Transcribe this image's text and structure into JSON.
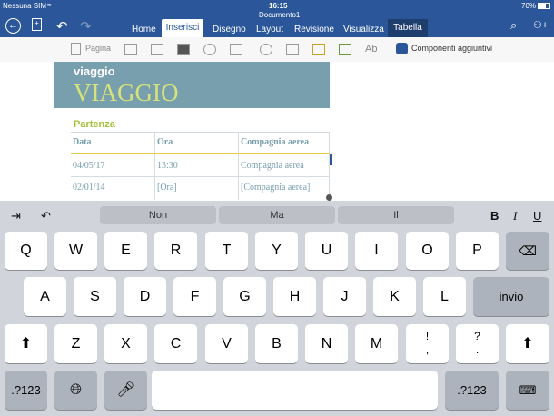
{
  "status": {
    "carrier": "Nessuna SIM",
    "time": "16:15",
    "battery": "70%",
    "doc_title": "Documento1"
  },
  "tabs": [
    "Home",
    "Inserisci",
    "Disegno",
    "Layout",
    "Revisione",
    "Visualizza",
    "Tabella"
  ],
  "ribbon": {
    "page_label": "Pagina",
    "wordart": "Ab",
    "addins_label": "Componenti aggiuntivi"
  },
  "doc": {
    "heading_small": "viaggio",
    "heading_big": "VIAGGIO",
    "section": "Partenza",
    "table_headers": [
      "Data",
      "Ora",
      "Compagnia aerea"
    ],
    "rows": [
      [
        "04/05/17",
        "13:30",
        "Compagnia aerea"
      ],
      [
        "02/01/14",
        "[Ora]",
        "[Compagnia aerea]"
      ]
    ]
  },
  "keyboard": {
    "suggestions": [
      "Non",
      "Ma",
      "Il"
    ],
    "format": [
      "B",
      "I",
      "U"
    ],
    "row1": [
      "Q",
      "W",
      "E",
      "R",
      "T",
      "Y",
      "U",
      "I",
      "O",
      "P"
    ],
    "row2": [
      "A",
      "S",
      "D",
      "F",
      "G",
      "H",
      "J",
      "K",
      "L"
    ],
    "return_label": "invio",
    "row3": [
      "Z",
      "X",
      "C",
      "V",
      "B",
      "N",
      "M"
    ],
    "punct1_top": "!",
    "punct1_bottom": ",",
    "punct2_top": "?",
    "punct2_bottom": ".",
    "numbers_label": ".?123"
  },
  "colors": {
    "word_blue": "#2b579a",
    "banner": "#789fae",
    "accent_green": "#a6c13a",
    "keyboard_bg": "#d1d5db"
  }
}
